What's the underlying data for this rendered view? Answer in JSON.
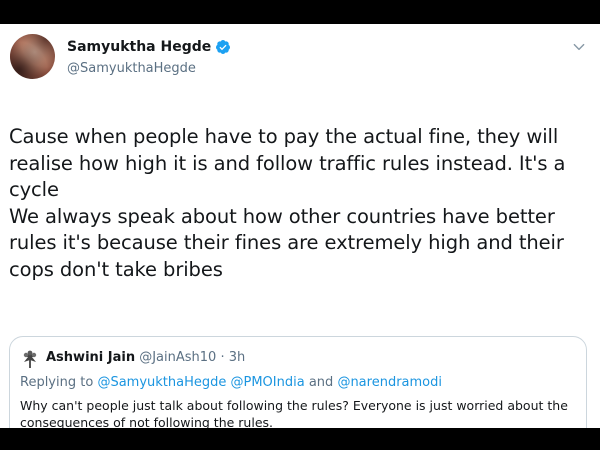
{
  "author": {
    "display_name": "Samyuktha Hegde",
    "handle": "@SamyukthaHegde",
    "verified": true
  },
  "tweet": {
    "text": "Cause when people have to pay the actual fine, they will realise how high it is and follow traffic rules instead. It's a cycle\nWe always speak about how other countries have better rules it's because their fines are extremely high and their cops don't take bribes"
  },
  "quoted_tweet": {
    "display_name": "Ashwini Jain",
    "handle": "@JainAsh10",
    "separator": " · ",
    "time": "3h",
    "replying_prefix": "Replying to ",
    "replying_to": [
      "@SamyukthaHegde",
      "@PMOIndia",
      "@narendramodi"
    ],
    "replying_joiner": " and ",
    "text": "Why can't people just talk about following the rules? Everyone is just worried about the consequences of not following the rules."
  },
  "icons": {
    "verified": "verified-badge-icon",
    "caret": "chevron-down-icon",
    "quoted_avatar": "tree-avatar-icon"
  },
  "colors": {
    "verified_blue": "#1da1f2",
    "link_blue": "#1b95e0",
    "text": "#14171a",
    "secondary_text": "#5b7083",
    "border": "#ccd6dd",
    "letterbox": "#000000"
  }
}
